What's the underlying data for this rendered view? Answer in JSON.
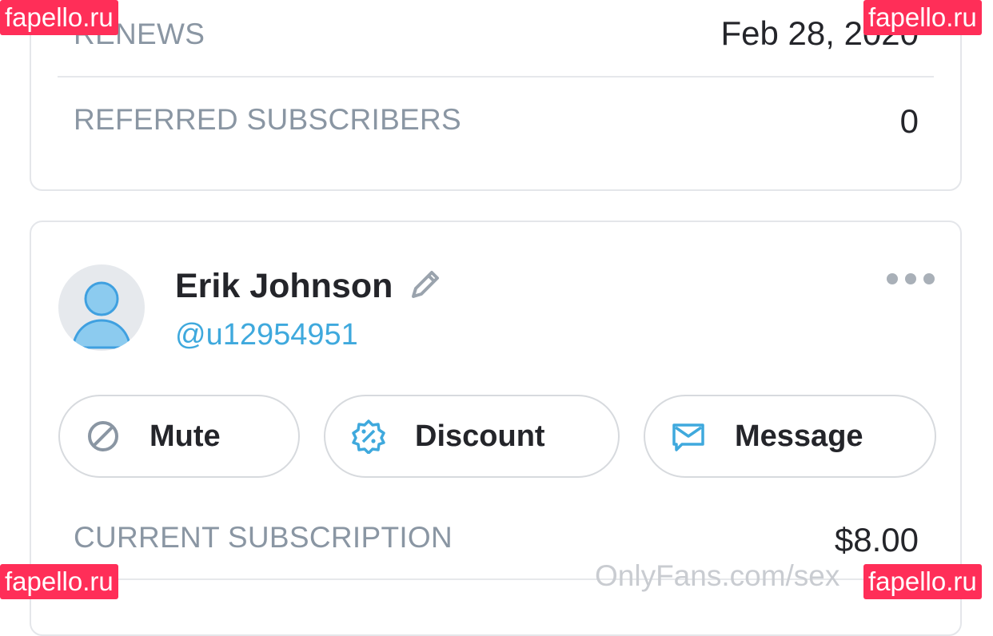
{
  "details_card": {
    "renews_label": "RENEWS",
    "renews_value": "Feb 28, 2020",
    "referred_label": "REFERRED SUBSCRIBERS",
    "referred_value": "0"
  },
  "subscriber_card": {
    "name": "Erik Johnson",
    "handle": "@u12954951",
    "actions": {
      "mute": "Mute",
      "discount": "Discount",
      "message": "Message"
    },
    "current_subscription_label": "CURRENT SUBSCRIPTION",
    "current_subscription_value": "$8.00"
  },
  "icons": {
    "edit": "pencil-icon",
    "more": "more-dots-icon",
    "mute": "ban-icon",
    "discount": "percent-badge-icon",
    "message": "envelope-icon",
    "avatar": "user-silhouette-icon"
  },
  "colors": {
    "accent": "#3fa9dd",
    "label_gray": "#8a96a3",
    "text_dark": "#24252a",
    "border": "#e4e6ea",
    "watermark": "#ff2e58"
  },
  "watermarks": {
    "brand": "fapello.ru",
    "site": "OnlyFans.com/sex"
  }
}
